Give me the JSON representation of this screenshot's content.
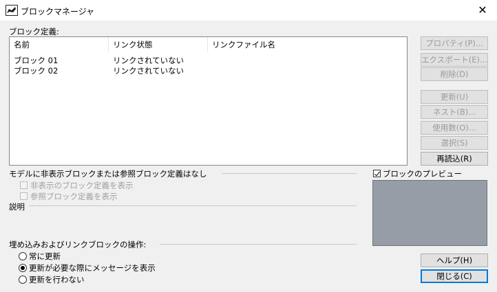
{
  "window": {
    "title": "ブロックマネージャ",
    "close_glyph": "✕"
  },
  "definitions": {
    "label": "ブロック定義:",
    "columns": [
      "名前",
      "リンク状態",
      "リンクファイル名"
    ],
    "rows": [
      {
        "name": "ブロック 01",
        "status": "リンクされていない",
        "file": ""
      },
      {
        "name": "ブロック 02",
        "status": "リンクされていない",
        "file": ""
      }
    ]
  },
  "buttons": {
    "properties": "プロパティ(P)...",
    "export": "エクスポート(E)...",
    "delete": "削除(D)",
    "update": "更新(U)",
    "nest": "ネスト(B)...",
    "count": "使用数(O)...",
    "select": "選択(S)",
    "reload": "再読込(R)",
    "help": "ヘルプ(H)",
    "close": "閉じる(C)"
  },
  "status_message": "モデルに非表示ブロックまたは参照ブロック定義はなし",
  "options": {
    "show_hidden": "非表示のブロック定義を表示",
    "show_reference": "参照ブロック定義を表示"
  },
  "description_label": "説明",
  "preview": {
    "label": "ブロックのプレビュー",
    "checked": true
  },
  "operations": {
    "label": "埋め込みおよびリンクブロックの操作:",
    "choices": [
      "常に更新",
      "更新が必要な際にメッセージを表示",
      "更新を行わない"
    ],
    "selected_index": 1
  }
}
